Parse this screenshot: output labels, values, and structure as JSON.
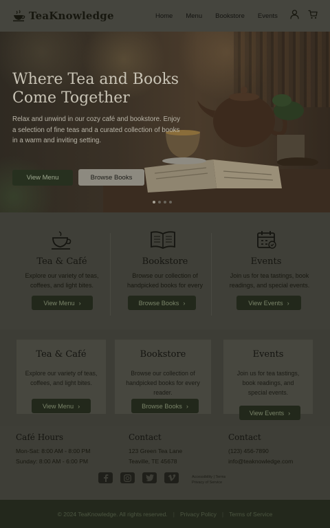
{
  "brand": {
    "name": "TeaKnowledge"
  },
  "nav": {
    "items": [
      "Home",
      "Menu",
      "Bookstore",
      "Events"
    ]
  },
  "hero": {
    "title": "Where Tea and Books Come Together",
    "text": "Relax and unwind in our cozy café and bookstore. Enjoy a selection of fine teas and a curated collection of books in a warm and inviting setting.",
    "primary_button": "View Menu",
    "secondary_button": "Browse Books",
    "slides_total": 4,
    "slide_active": 1
  },
  "features": [
    {
      "title": "Tea & Café",
      "text": "Explore our variety of teas, coffees, and light bites.",
      "button": "View Menu",
      "icon": "teacup-icon"
    },
    {
      "title": "Bookstore",
      "text": "Browse our collection of handpicked books for every",
      "button": "Browse Books",
      "icon": "open-book-icon"
    },
    {
      "title": "Events",
      "text": "Join us for tea tastings, book readings, and special events.",
      "button": "View Events",
      "icon": "calendar-icon"
    }
  ],
  "cards": [
    {
      "title": "Tea & Café",
      "text": "Explore our variety of teas, coffees, and light bites.",
      "button": "View Menu"
    },
    {
      "title": "Bookstore",
      "text": "Browse our collection of handpicked books for every reader.",
      "button": "Browse Books"
    },
    {
      "title": "Events",
      "text": "Join us for tea tastings, book readings, and special events.",
      "button": "View Events"
    }
  ],
  "footer": {
    "hours": {
      "title": "Café Hours",
      "lines": [
        "Mon-Sat: 8:00 AM - 8:00 PM",
        "Sunday: 8:00 AM - 6:00 PM"
      ]
    },
    "contact_address": {
      "title": "Contact",
      "lines": [
        "123 Green Tea Lane",
        "Teaville, TE 45678"
      ]
    },
    "contact_phone": {
      "title": "Contact",
      "lines": [
        "(123) 456-7890",
        "info@teaknowledge.com"
      ]
    },
    "small_links": [
      "Accessibility | Terms",
      "Privacy of Service"
    ],
    "socials": [
      "facebook-icon",
      "instagram-icon",
      "twitter-icon",
      "vimeo-icon"
    ],
    "copyright": "© 2024 TeaKnowledge. All rights reserved.",
    "privacy": "Privacy Policy",
    "terms": "Terms of Service"
  },
  "colors": {
    "overlay": "#3b3b34",
    "accent_dark": "#22281b",
    "button_text": "#7a8469"
  }
}
